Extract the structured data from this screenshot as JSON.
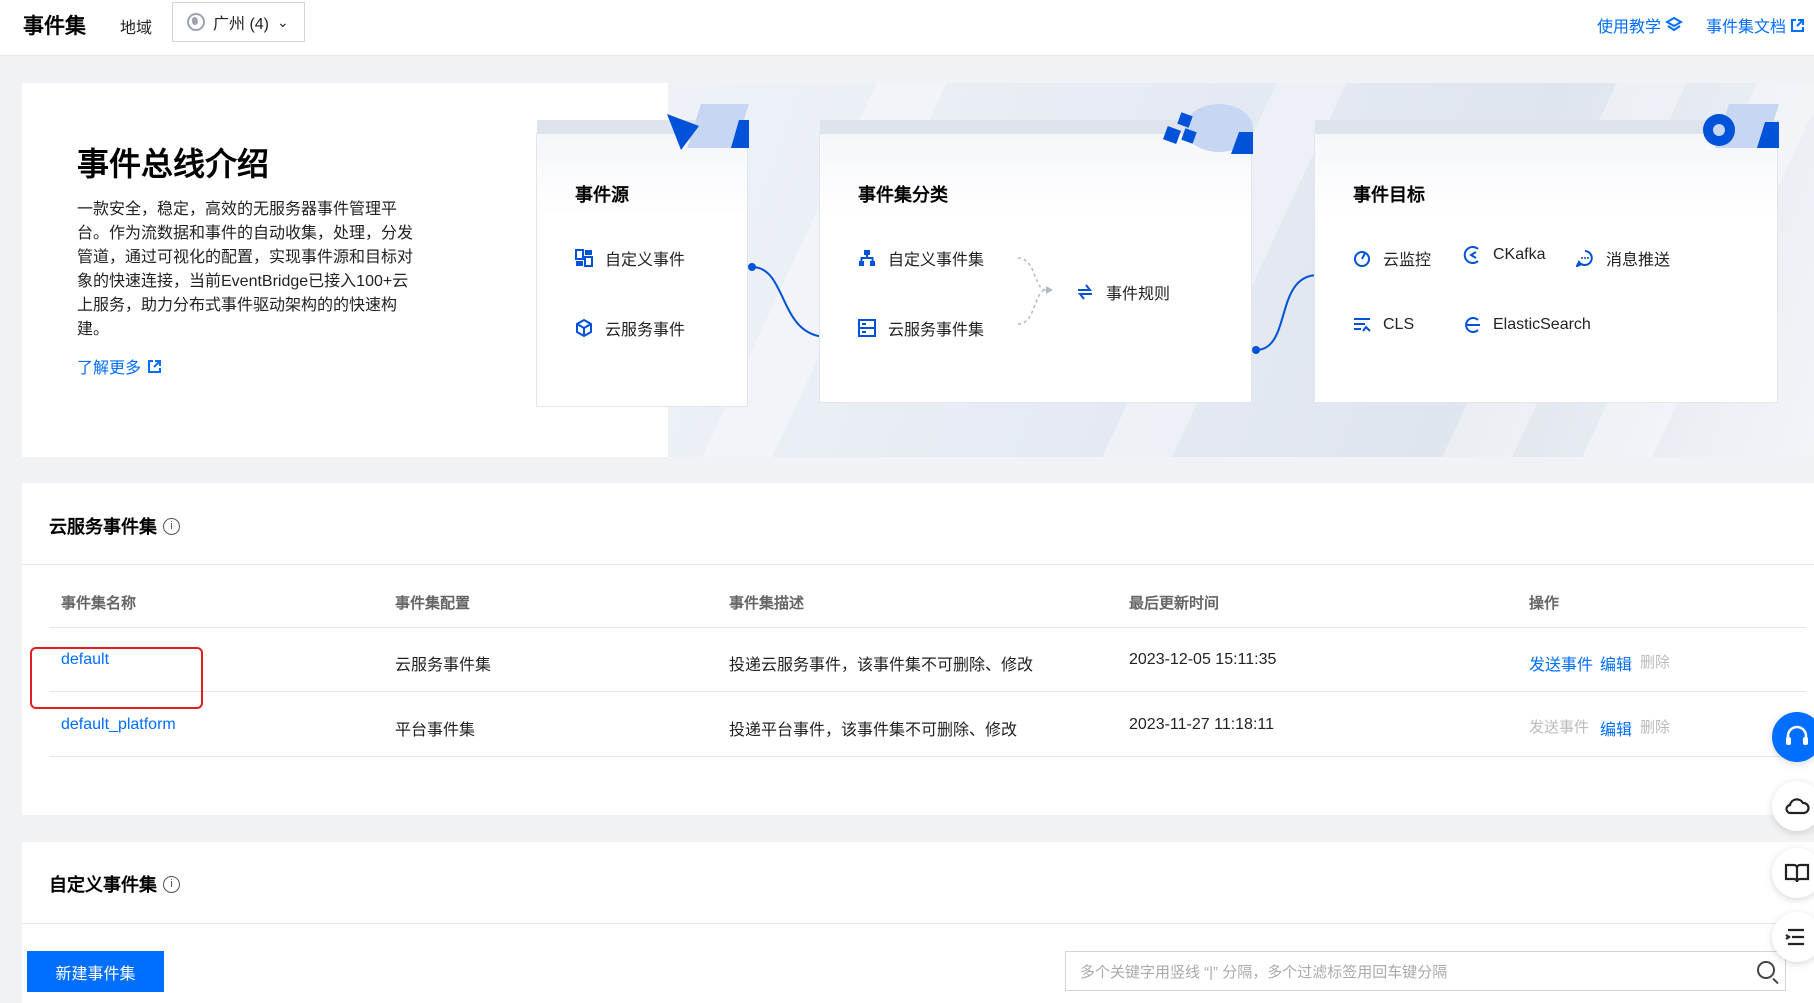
{
  "header": {
    "title": "事件集",
    "region_label": "地域",
    "region_value": "广州 (4)",
    "links": {
      "tutorial": "使用教学",
      "docs": "事件集文档"
    }
  },
  "intro": {
    "title": "事件总线介绍",
    "description": "一款安全，稳定，高效的无服务器事件管理平台。作为流数据和事件的自动收集，处理，分发管道，通过可视化的配置，实现事件源和目标对象的快速连接，当前EventBridge已接入100+云上服务，助力分布式事件驱动架构的的快速构建。",
    "learn_more": "了解更多",
    "sources": {
      "title": "事件源",
      "items": [
        "自定义事件",
        "云服务事件"
      ]
    },
    "categories": {
      "title": "事件集分类",
      "items": [
        "自定义事件集",
        "云服务事件集"
      ],
      "rule": "事件规则"
    },
    "targets": {
      "title": "事件目标",
      "items": [
        "云监控",
        "CKafka",
        "消息推送",
        "CLS",
        "ElasticSearch"
      ]
    }
  },
  "cloud_section": {
    "title": "云服务事件集",
    "columns": [
      "事件集名称",
      "事件集配置",
      "事件集描述",
      "最后更新时间",
      "操作"
    ],
    "rows": [
      {
        "name": "default",
        "config": "云服务事件集",
        "desc": "投递云服务事件，该事件集不可删除、修改",
        "updated": "2023-12-05 15:11:35",
        "actions": [
          "发送事件",
          "编辑",
          "删除"
        ]
      },
      {
        "name": "default_platform",
        "config": "平台事件集",
        "desc": "投递平台事件，该事件集不可删除、修改",
        "updated": "2023-11-27 11:18:11",
        "actions": [
          "发送事件",
          "编辑",
          "删除"
        ]
      }
    ]
  },
  "custom_section": {
    "title": "自定义事件集",
    "create_button": "新建事件集",
    "search_placeholder": "多个关键字用竖线 “|” 分隔，多个过滤标签用回车键分隔"
  },
  "colors": {
    "accent": "#006eff",
    "highlight_border": "#e02020",
    "disabled": "#bbbbbb"
  },
  "icons": [
    "globe-icon",
    "chevron-down-icon",
    "tutorial-icon",
    "external-link-icon",
    "info-icon",
    "search-icon",
    "support-icon",
    "cloud-icon",
    "book-icon",
    "list-icon"
  ]
}
